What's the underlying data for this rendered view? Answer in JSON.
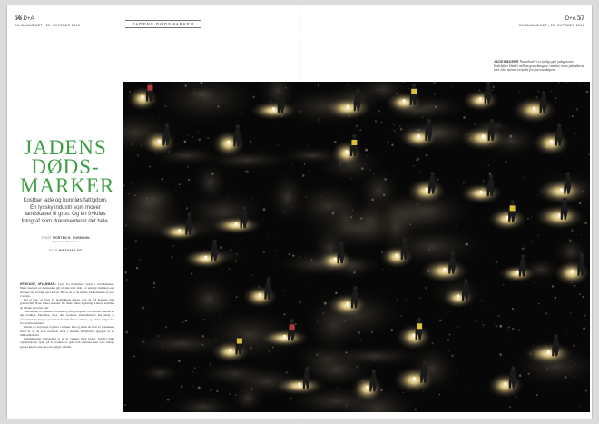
{
  "folio": {
    "left_page": "56",
    "left_logo": "D+A",
    "left_pub": "DN MAGASINET | 20. OKTOBER 2018",
    "right_page": "57",
    "right_logo": "D+A",
    "right_pub": "DN MAGASINET | 20. OKTOBER 2018"
  },
  "section_label": "JADENS DØDSMARKER",
  "headline": [
    "JADENS",
    "DØDS-",
    "MARKER"
  ],
  "deck": "Kostbar jade og bunnløs fattigdom. En lyssky industri som mover landskapet til grus. Og en fryktløs fotograf som dokumenterer det hele.",
  "credits": {
    "text_label": "TEKST",
    "text_name": "MORTEN H. NORMANN",
    "text_sub": "Kaphein, Myanmar",
    "photo_label": "FOTO",
    "photo_name": "MINZAYAR OO"
  },
  "body": {
    "dateline": "HPAKANT, MYANMAR:",
    "paragraphs": [
      "Lyset fra hodelykter lysere i kveldsmørket. Mens tusenvis av mennesker går på jakt etter jade i et ødelagt landskap som strekker seg så langt øyet kan se. Her er en av de største forekomstene av jade i verden.",
      "Det er natt, og lyset fra hodelyktene danser over de grå haugene med gruveavfall. Noen finner en stein. De fleste finner ingenting. Likevel kommer de tilbake natt etter natt.",
      "Velkommen til Hpakant, en mørk og farlig helgedel i en sentralt område av det nordlige Myanmar, hvor den kostbare jadeindustrien har skapt et økonomisk kretsløp. I provinsen Kachin finnes steinen, og i Kina selges den for enorme summer.",
      "Landet er i ferd med å graves i stykker. Ras og skred tar livet av jadesøkere hvert år, og de som overlever lever i ekstrem fattigdom i skyggen av en milliardindustri.",
      "Jadeindustrien i Myanmar er en av verdens mest lyssky. Tall fra ulike organisasjoner tyder på at verdien av jade som utvinnes kan være mange ganger høyere enn det som oppgis offisielt."
    ]
  },
  "caption": {
    "label": "JADESØKERE",
    "text": "Nattarbeid er et vanlig syn i jadegruvene. Hodelykter blinker mellom gruvehaugene i mørket, mens jadesøkerne leter etter steiner i avfallet fra gruveselskapene."
  },
  "photo": {
    "description_icon": "mining-night-photo"
  }
}
